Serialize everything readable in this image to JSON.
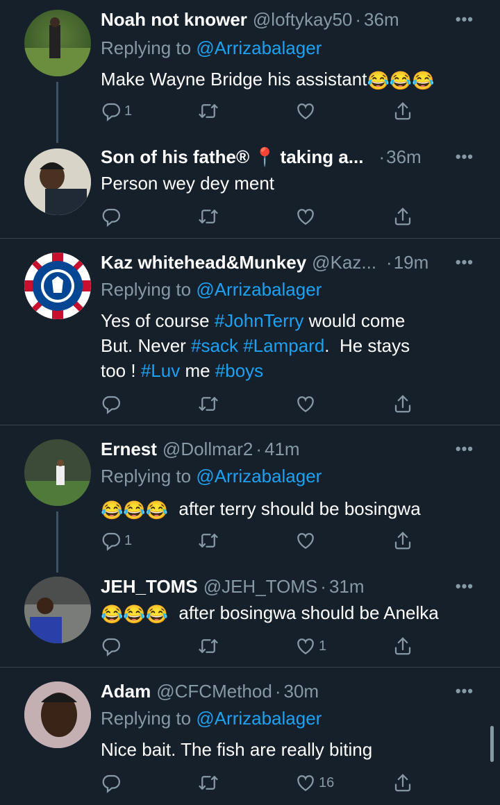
{
  "tweets": [
    {
      "name": "Noah not knower",
      "handle": "@loftykay50",
      "sep": "·",
      "time": "36m",
      "replying_prefix": "Replying to ",
      "replying_to": "@Arrizabalager",
      "text": "Make Wayne Bridge his assistant",
      "emoji": "😂😂😂",
      "reply_count": "1",
      "retweet_count": "",
      "like_count": ""
    },
    {
      "name": "Son of his fathe®",
      "pin_emoji": "📍",
      "name_tail": "taking a...",
      "sep": "·",
      "time": "36m",
      "text": "Person wey dey ment",
      "reply_count": "",
      "retweet_count": "",
      "like_count": ""
    },
    {
      "name": "Kaz whitehead&Munkey",
      "handle": "@Kaz...",
      "sep": "·",
      "time": "19m",
      "replying_prefix": "Replying to ",
      "replying_to": "@Arrizabalager",
      "line1_a": "Yes of course ",
      "line1_tag": "#JohnTerry",
      "line1_b": " would come",
      "line2_a": "But. Never ",
      "line2_tag1": "#sack",
      "line2_sp": " ",
      "line2_tag2": "#Lampard",
      "line2_b": ".  He stays",
      "line3_a": "too ! ",
      "line3_tag1": "#Luv",
      "line3_b": " me ",
      "line3_tag2": "#boys",
      "reply_count": "",
      "retweet_count": "",
      "like_count": ""
    },
    {
      "name": "Ernest",
      "handle": "@Dollmar2",
      "sep": "·",
      "time": "41m",
      "replying_prefix": "Replying to ",
      "replying_to": "@Arrizabalager",
      "emoji": "😂😂😂",
      "text": "after terry should be bosingwa",
      "reply_count": "1",
      "retweet_count": "",
      "like_count": ""
    },
    {
      "name": "JEH_TOMS",
      "handle": "@JEH_TOMS",
      "sep": "·",
      "time": "31m",
      "emoji": "😂😂😂",
      "text": "after bosingwa should be Anelka",
      "reply_count": "",
      "retweet_count": "",
      "like_count": "1"
    },
    {
      "name": "Adam",
      "handle": "@CFCMethod",
      "sep": "·",
      "time": "30m",
      "replying_prefix": "Replying to ",
      "replying_to": "@Arrizabalager",
      "text": "Nice bait. The fish are really biting",
      "reply_count": "",
      "retweet_count": "",
      "like_count": "16"
    }
  ],
  "more_label": "•••",
  "colors": {
    "background": "#15202b",
    "accent": "#1da1f2",
    "muted": "#8899a6",
    "divider": "#38444d"
  }
}
